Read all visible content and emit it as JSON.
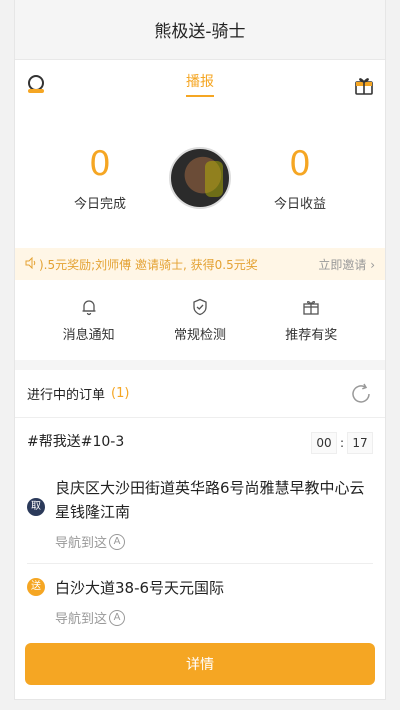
{
  "title": "熊极送-骑士",
  "tabs": {
    "active": "播报"
  },
  "stats": {
    "completed": {
      "value": "0",
      "label": "今日完成"
    },
    "earnings": {
      "value": "0",
      "label": "今日收益"
    }
  },
  "notice": {
    "text": ").5元奖励;刘师傅  邀请骑士, 获得0.5元奖",
    "action": "立即邀请",
    "chevron": "›"
  },
  "quick_actions": [
    {
      "label": "消息通知",
      "icon": "bell-icon"
    },
    {
      "label": "常规检测",
      "icon": "shield-check-icon"
    },
    {
      "label": "推荐有奖",
      "icon": "gift-icon"
    }
  ],
  "orders": {
    "title": "进行中的订单",
    "count": "(1)",
    "order_id": "#帮我送#10-3",
    "timer": {
      "minutes": "00",
      "colon": ":",
      "seconds": "17"
    },
    "pickup": {
      "badge": "取",
      "address": "良庆区大沙田街道英华路6号尚雅慧早教中心云星钱隆江南",
      "nav": "导航到这"
    },
    "dropoff": {
      "badge": "送",
      "address": "白沙大道38-6号天元国际",
      "nav": "导航到这"
    },
    "detail_button": "详情"
  },
  "colors": {
    "accent": "#f5a623",
    "pickup_badge": "#2b3a5a"
  }
}
